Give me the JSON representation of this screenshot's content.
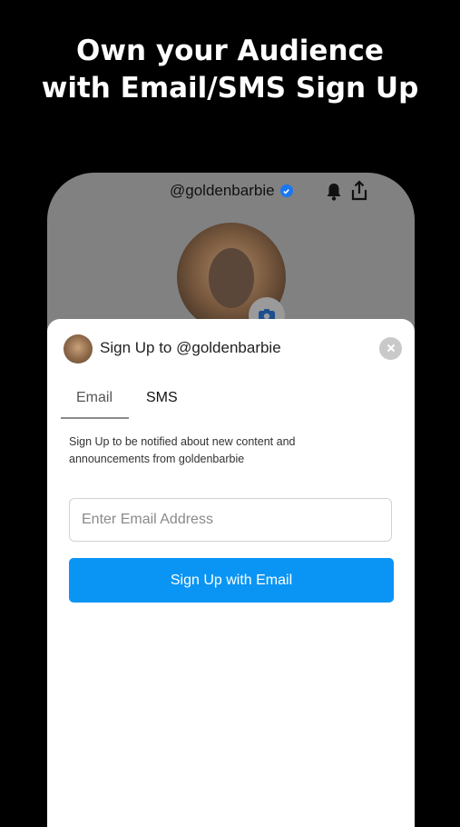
{
  "promo": {
    "headline_line1": "Own your Audience",
    "headline_line2": "with Email/SMS Sign Up"
  },
  "profile": {
    "handle": "@goldenbarbie",
    "icons": [
      "verified-badge-icon",
      "bell-icon",
      "share-icon",
      "camera-icon"
    ]
  },
  "signup_sheet": {
    "title": "Sign Up to @goldenbarbie",
    "tabs": [
      {
        "label": "Email",
        "active": true
      },
      {
        "label": "SMS",
        "active": false
      }
    ],
    "description": "Sign Up to be notified about new content and announcements from goldenbarbie",
    "email_placeholder": "Enter Email Address",
    "email_value": "",
    "submit_label": "Sign Up with Email"
  },
  "colors": {
    "background": "#000000",
    "accent": "#0a95f4",
    "verified": "#1877f2"
  }
}
